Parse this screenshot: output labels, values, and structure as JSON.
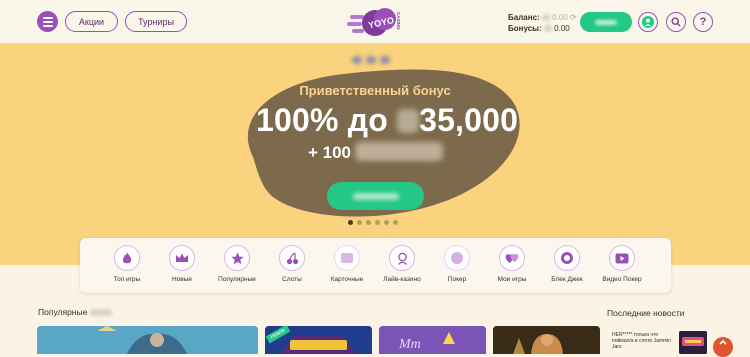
{
  "header": {
    "nav": [
      "Акции",
      "Турниры"
    ],
    "logo_text": "YOYO",
    "logo_sub": "CASINO",
    "balance_label": "Баланс:",
    "balance_value": "0.00",
    "bonus_label": "Бонусы:",
    "bonus_value": "0.00"
  },
  "banner": {
    "title": "Приветственный бонус",
    "amount_prefix": "100% до",
    "amount_value": "35,000",
    "extra_prefix": "+ 100",
    "slide_count": 6,
    "active_slide": 1
  },
  "categories": [
    {
      "label": "Топ игры",
      "icon": "fire-icon"
    },
    {
      "label": "Новые",
      "icon": "crown-icon"
    },
    {
      "label": "Популярные",
      "icon": "star-icon"
    },
    {
      "label": "Слоты",
      "icon": "cherry-icon"
    },
    {
      "label": "Карточные",
      "icon": "cards-icon"
    },
    {
      "label": "Лайв-казино",
      "icon": "dealer-icon"
    },
    {
      "label": "Покер",
      "icon": "poker-chip-icon"
    },
    {
      "label": "Мои игры",
      "icon": "hearts-icon"
    },
    {
      "label": "Блек Джек",
      "icon": "blackjack-icon"
    },
    {
      "label": "Видео Покер",
      "icon": "video-play-icon"
    }
  ],
  "popular": {
    "title": "Популярные"
  },
  "game_cards": [
    {
      "badge": ""
    },
    {
      "badge": "Новое"
    },
    {
      "badge": ""
    },
    {
      "badge": ""
    }
  ],
  "news": {
    "title": "Последние новости",
    "item_text": "HER***** только что поймал/а в слоте Jammin Jars"
  },
  "colors": {
    "accent_purple": "#9b4fb8",
    "accent_green": "#23c786",
    "banner_bg": "#fbd27e",
    "blob_brown": "#7d6a4d"
  }
}
